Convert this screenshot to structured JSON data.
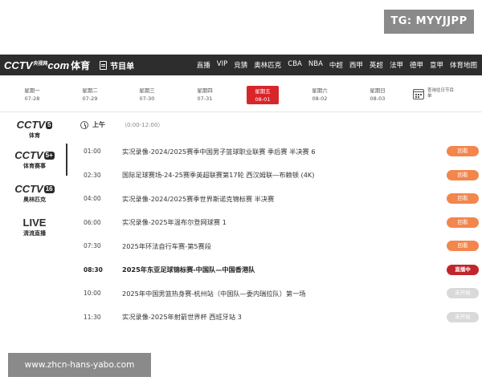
{
  "watermark_top": "TG: MYYJJPP",
  "watermark_bottom": "www.zhcn-hans-yabo.com",
  "header": {
    "logo_text": "CCTV",
    "logo_tiny": "央视网",
    "logo_com": "com",
    "logo_sub": "体育",
    "schedule_label": "节目单",
    "nav": [
      "直播",
      "VIP",
      "竞猜",
      "奥林匹克",
      "CBA",
      "NBA",
      "中超",
      "西甲",
      "英超",
      "法甲",
      "德甲",
      "意甲",
      "体育地图"
    ]
  },
  "dates": [
    {
      "weekday": "星期一",
      "date": "07-28"
    },
    {
      "weekday": "星期二",
      "date": "07-29"
    },
    {
      "weekday": "星期三",
      "date": "07-30"
    },
    {
      "weekday": "星期四",
      "date": "07-31"
    },
    {
      "weekday": "星期五",
      "date": "08-01"
    },
    {
      "weekday": "星期六",
      "date": "08-02"
    },
    {
      "weekday": "星期日",
      "date": "08-03"
    }
  ],
  "calendar_label": "查询往日节目单",
  "channels": [
    {
      "logo": "CCTV",
      "badge": "5",
      "sub": "体育"
    },
    {
      "logo": "CCTV",
      "badge": "5+",
      "sub": "体育赛事"
    },
    {
      "logo": "CCTV",
      "badge": "16",
      "sub": "奥林匹克"
    },
    {
      "logo": "LIVE",
      "badge": "",
      "sub": "清流直播"
    }
  ],
  "section": {
    "title": "上午",
    "range": "（0:00-12:00）"
  },
  "programs": [
    {
      "time": "01:00",
      "title": "实况录像-2024/2025赛季中国男子篮球职业联赛 季后赛 半决赛 6",
      "status": "回看"
    },
    {
      "time": "02:30",
      "title": "国际足球赛场-24-25赛季英超联赛第17轮 西汉姆联—布赖顿 (4K)",
      "status": "回看"
    },
    {
      "time": "04:00",
      "title": "实况录像-2024/2025赛季世界斯诺克锦标赛 半决赛",
      "status": "回看"
    },
    {
      "time": "06:00",
      "title": "实况录像-2025年温布尔登网球赛 1",
      "status": "回看"
    },
    {
      "time": "07:30",
      "title": "2025年环法自行车赛-第5赛段",
      "status": "回看"
    },
    {
      "time": "08:30",
      "title": "2025年东亚足球锦标赛-中国队—中国香港队",
      "status": "直播中"
    },
    {
      "time": "10:00",
      "title": "2025年中国男篮热身赛-杭州站（中国队—委内瑞拉队）第一场",
      "status": "未开始"
    },
    {
      "time": "11:30",
      "title": "实况录像-2025年射箭世界杯 西班牙站 3",
      "status": "未开始"
    }
  ]
}
